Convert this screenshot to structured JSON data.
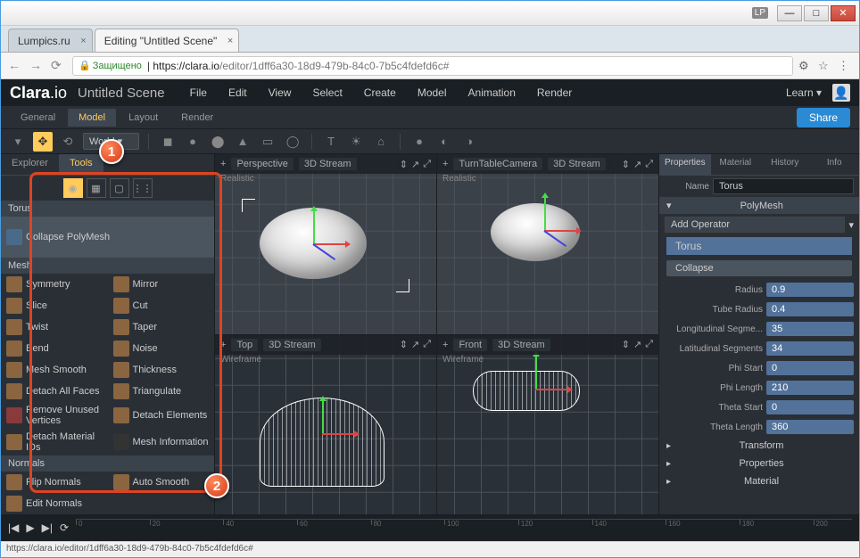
{
  "browser": {
    "lp_badge": "LP",
    "tabs": [
      {
        "title": "Lumpics.ru",
        "active": false
      },
      {
        "title": "Editing \"Untitled Scene\"",
        "active": true
      }
    ],
    "secure_label": "Защищено",
    "url_domain": "https://clara.io",
    "url_path": "/editor/1dff6a30-18d9-479b-84c0-7b5c4fdefd6c#",
    "status": "https://clara.io/editor/1dff6a30-18d9-479b-84c0-7b5c4fdefd6c#"
  },
  "app": {
    "logo": "Clara.io",
    "scene": "Untitled Scene",
    "menus": [
      "File",
      "Edit",
      "View",
      "Select",
      "Create",
      "Model",
      "Animation",
      "Render"
    ],
    "learn": "Learn",
    "mode_tabs": [
      "General",
      "Model",
      "Layout",
      "Render"
    ],
    "active_mode": "Model",
    "share": "Share",
    "space": "World"
  },
  "left": {
    "tabs": [
      "Explorer",
      "Tools"
    ],
    "active_tab": "Tools",
    "obj_header": "Torus",
    "collapse": "Collapse PolyMesh",
    "mesh_header": "Mesh",
    "mesh_tools": [
      [
        "Symmetry",
        "Mirror"
      ],
      [
        "Slice",
        "Cut"
      ],
      [
        "Twist",
        "Taper"
      ],
      [
        "Bend",
        "Noise"
      ],
      [
        "Mesh Smooth",
        "Thickness"
      ],
      [
        "Detach All Faces",
        "Triangulate"
      ],
      [
        "Remove Unused Vertices",
        "Detach Elements"
      ],
      [
        "Detach Material IDs",
        "Mesh Information"
      ]
    ],
    "normals_header": "Normals",
    "normal_tools": [
      [
        "Flip Normals",
        "Auto Smooth"
      ],
      [
        "Edit Normals",
        ""
      ]
    ]
  },
  "viewports": {
    "persp": {
      "name": "Perspective",
      "mode": "3D Stream",
      "shade": "Realistic"
    },
    "turn": {
      "name": "TurnTableCamera",
      "mode": "3D Stream",
      "shade": "Realistic"
    },
    "top": {
      "name": "Top",
      "mode": "3D Stream",
      "shade": "Wireframe"
    },
    "front": {
      "name": "Front",
      "mode": "3D Stream",
      "shade": "Wireframe"
    }
  },
  "props": {
    "tabs": [
      "Properties",
      "Material",
      "History",
      "Info"
    ],
    "name_lbl": "Name",
    "name_val": "Torus",
    "type": "PolyMesh",
    "add_op": "Add Operator",
    "torus_op": "Torus",
    "collapse": "Collapse",
    "params": [
      {
        "lbl": "Radius",
        "val": "0.9"
      },
      {
        "lbl": "Tube Radius",
        "val": "0.4"
      },
      {
        "lbl": "Longitudinal Segme...",
        "val": "35"
      },
      {
        "lbl": "Latitudinal Segments",
        "val": "34"
      },
      {
        "lbl": "Phi Start",
        "val": "0"
      },
      {
        "lbl": "Phi Length",
        "val": "210"
      },
      {
        "lbl": "Theta Start",
        "val": "0"
      },
      {
        "lbl": "Theta Length",
        "val": "360"
      }
    ],
    "sections": [
      "Transform",
      "Properties",
      "Material"
    ]
  },
  "timeline": {
    "ticks": [
      "0",
      "20",
      "40",
      "60",
      "80",
      "100",
      "120",
      "140",
      "160",
      "180",
      "200"
    ]
  },
  "callouts": {
    "c1": "1",
    "c2": "2"
  }
}
